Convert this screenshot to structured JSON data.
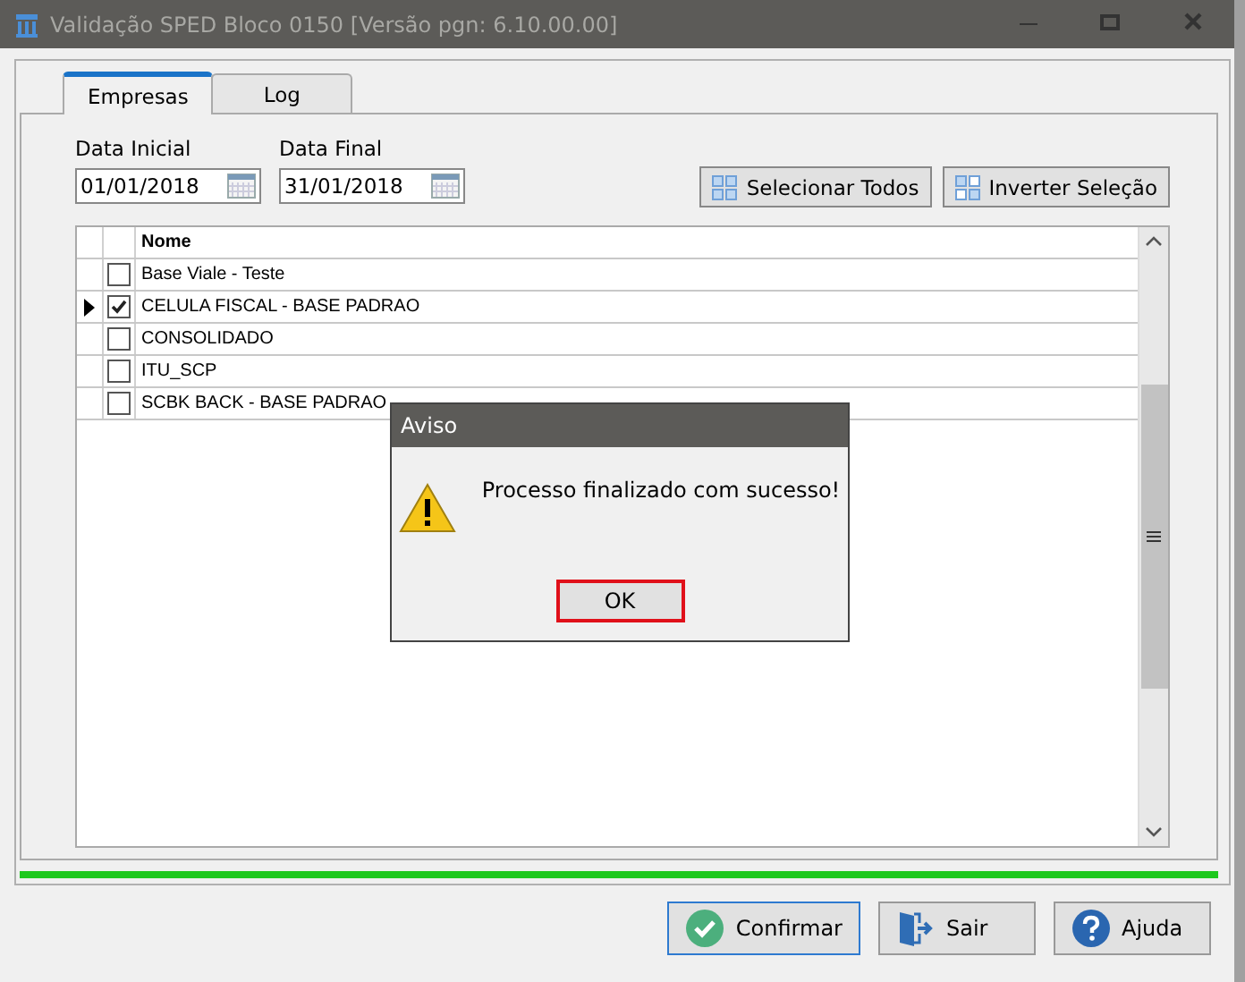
{
  "window": {
    "title": "Validação SPED Bloco 0150 [Versão pgn: 6.10.00.00]"
  },
  "tabs": [
    {
      "label": "Empresas",
      "selected": true
    },
    {
      "label": "Log",
      "selected": false
    }
  ],
  "date_fields": [
    {
      "label": "Data Inicial",
      "value": "01/01/2018"
    },
    {
      "label": "Data Final",
      "value": "31/01/2018"
    }
  ],
  "selection_buttons": [
    {
      "label": "Selecionar Todos",
      "kind": "select-all"
    },
    {
      "label": "Inverter Seleção",
      "kind": "invert"
    }
  ],
  "grid": {
    "columns": [
      "Nome"
    ],
    "rows": [
      {
        "name": "Base Viale - Teste",
        "checked": false,
        "current": false
      },
      {
        "name": "CELULA FISCAL - BASE PADRAO",
        "checked": true,
        "current": true
      },
      {
        "name": "CONSOLIDADO",
        "checked": false,
        "current": false
      },
      {
        "name": "ITU_SCP",
        "checked": false,
        "current": false
      },
      {
        "name": "SCBK BACK - BASE PADRAO",
        "checked": false,
        "current": false
      }
    ]
  },
  "progress": {
    "level": 1
  },
  "dialog": {
    "title": "Aviso",
    "message": "Processo finalizado com sucesso!",
    "button": "OK"
  },
  "buttons": [
    {
      "label": "Confirmar",
      "kind": "confirm",
      "focused": true
    },
    {
      "label": "Sair",
      "kind": "exit",
      "focused": false
    },
    {
      "label": "Ajuda",
      "kind": "help",
      "focused": false
    }
  ]
}
